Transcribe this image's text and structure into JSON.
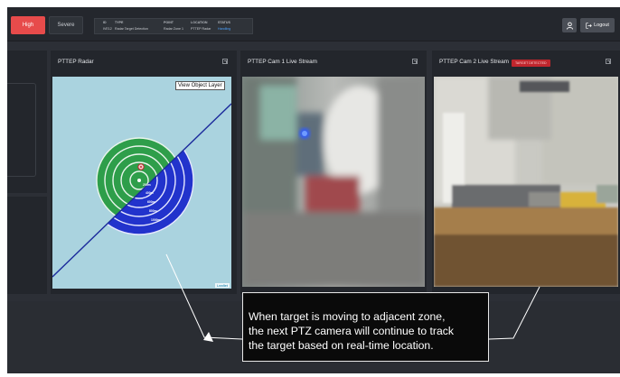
{
  "topbar": {
    "high_label": "High",
    "severe_label": "Severe",
    "info": {
      "id_header": "ID",
      "id_value": "IVE12",
      "type_header": "TYPE",
      "type_value": "Radar Target Detection",
      "point_header": "POINT",
      "point_value": "Radar Zone 1",
      "location_header": "LOCATION",
      "location_value": "PTTEP Radar",
      "status_header": "STATUS",
      "status_value": "Handling"
    },
    "logout_label": "Logout"
  },
  "panels": {
    "radar": {
      "title": "PTTEP Radar",
      "view_layer_label": "View Object Layer",
      "attribution": "Leaflet",
      "ring_labels": [
        "200m",
        "400m",
        "600m",
        "800m",
        "1000m"
      ]
    },
    "cam1": {
      "title": "PTTEP Cam 1 Live Stream"
    },
    "cam2": {
      "title": "PTTEP Cam 2 Live Stream",
      "badge": "TARGET DETECTED"
    }
  },
  "callout": {
    "lines": [
      "When target is moving to adjacent zone,",
      "the next PTZ camera will continue to track",
      "the target based on real-time location."
    ]
  },
  "colors": {
    "high": "#e74b4b",
    "status": "#4da3ff",
    "radar_green": "#2e9e4a",
    "radar_blue": "#2233cc",
    "map_water": "#aad3df",
    "badge": "#c0262d"
  }
}
